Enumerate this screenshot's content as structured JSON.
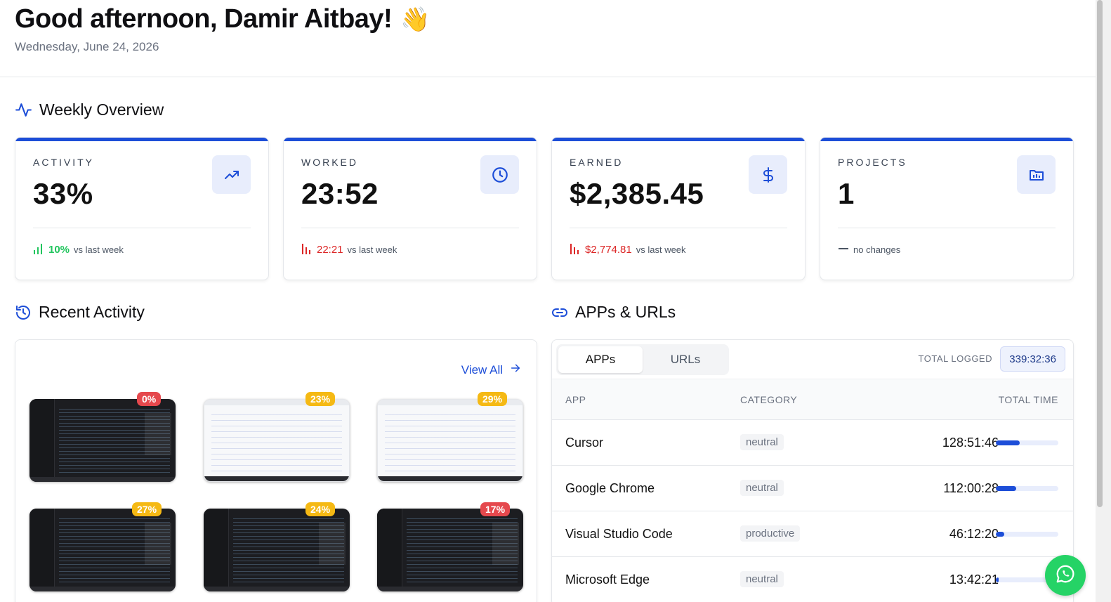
{
  "header": {
    "greeting": "Good afternoon, Damir Aitbay!",
    "wave_emoji": "👋",
    "date": "Wednesday, June 24, 2026"
  },
  "weekly": {
    "title": "Weekly Overview",
    "icon": "activity-pulse-icon",
    "cards": [
      {
        "label": "ACTIVITY",
        "value": "33%",
        "icon": "trending-up-icon",
        "delta": "10%",
        "delta_dir": "up",
        "delta_color": "#22c55e",
        "compare": "vs last week"
      },
      {
        "label": "WORKED",
        "value": "23:52",
        "icon": "clock-icon",
        "delta": "22:21",
        "delta_dir": "down",
        "delta_color": "#dc2626",
        "compare": "vs last week"
      },
      {
        "label": "EARNED",
        "value": "$2,385.45",
        "icon": "dollar-icon",
        "delta": "$2,774.81",
        "delta_dir": "down",
        "delta_color": "#dc2626",
        "compare": "vs last week"
      },
      {
        "label": "PROJECTS",
        "value": "1",
        "icon": "project-folder-icon",
        "delta": "",
        "delta_dir": "none",
        "compare": "no changes"
      }
    ]
  },
  "recent": {
    "title": "Recent Activity",
    "icon": "history-icon",
    "view_all": "View All",
    "thumbnails": [
      {
        "percent": "0%",
        "badge": "red",
        "theme": "dark"
      },
      {
        "percent": "23%",
        "badge": "yellow",
        "theme": "light"
      },
      {
        "percent": "29%",
        "badge": "yellow",
        "theme": "light"
      },
      {
        "percent": "27%",
        "badge": "yellow",
        "theme": "dark"
      },
      {
        "percent": "24%",
        "badge": "yellow",
        "theme": "dark"
      },
      {
        "percent": "17%",
        "badge": "red",
        "theme": "dark"
      }
    ]
  },
  "apps": {
    "title": "APPs & URLs",
    "icon": "link-icon",
    "tabs": [
      "APPs",
      "URLs"
    ],
    "active_tab": "APPs",
    "total_label": "TOTAL LOGGED",
    "total_value": "339:32:36",
    "columns": [
      "APP",
      "CATEGORY",
      "TOTAL TIME"
    ],
    "rows": [
      {
        "app": "Cursor",
        "category": "neutral",
        "time": "128:51:46",
        "share": 0.38
      },
      {
        "app": "Google Chrome",
        "category": "neutral",
        "time": "112:00:28",
        "share": 0.33
      },
      {
        "app": "Visual Studio Code",
        "category": "productive",
        "time": "46:12:20",
        "share": 0.14
      },
      {
        "app": "Microsoft Edge",
        "category": "neutral",
        "time": "13:42:21",
        "share": 0.04
      }
    ]
  },
  "colors": {
    "accent": "#1d4ed8",
    "up": "#22c55e",
    "down": "#dc2626",
    "badge_red": "#e5484d",
    "badge_yellow": "#f5b914",
    "whatsapp": "#25d366"
  },
  "chat_button": {
    "icon": "whatsapp-icon"
  }
}
